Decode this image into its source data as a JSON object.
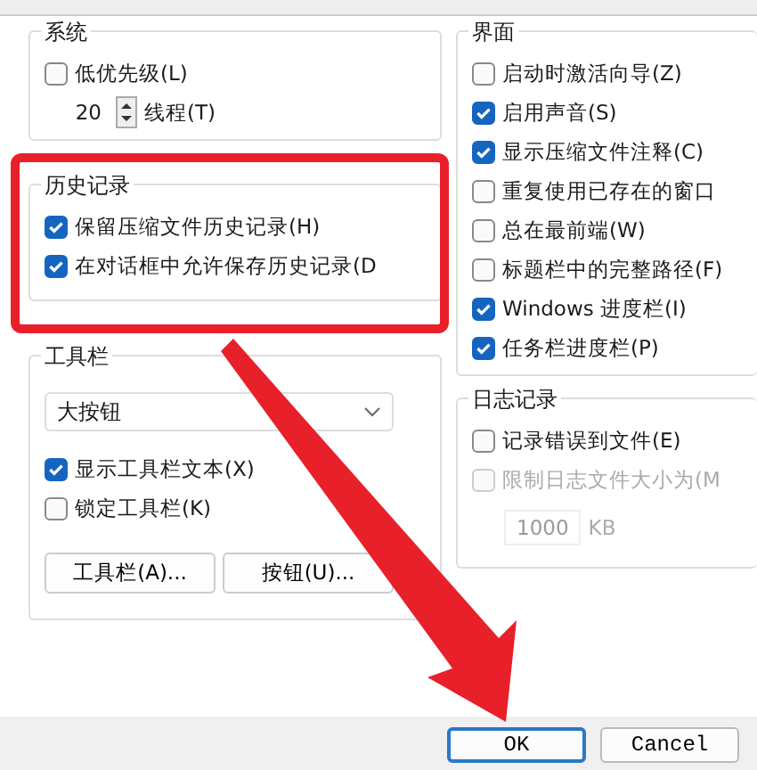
{
  "system": {
    "title": "系统",
    "low_priority": {
      "label": "低优先级(L)",
      "checked": false
    },
    "threads": {
      "value": "20",
      "label": "线程(T)"
    }
  },
  "history": {
    "title": "历史记录",
    "options": [
      {
        "label": "保留压缩文件历史记录(H)",
        "checked": true
      },
      {
        "label": "在对话框中允许保存历史记录(D",
        "checked": true
      }
    ]
  },
  "toolbar": {
    "title": "工具栏",
    "style": "大按钮",
    "options": [
      {
        "label": "显示工具栏文本(X)",
        "checked": true
      },
      {
        "label": "锁定工具栏(K)",
        "checked": false
      }
    ],
    "buttons": [
      "工具栏(A)...",
      "按钮(U)..."
    ]
  },
  "interface": {
    "title": "界面",
    "options": [
      {
        "label": "启动时激活向导(Z)",
        "checked": false
      },
      {
        "label": "启用声音(S)",
        "checked": true
      },
      {
        "label": "显示压缩文件注释(C)",
        "checked": true
      },
      {
        "label": "重复使用已存在的窗口",
        "checked": false
      },
      {
        "label": "总在最前端(W)",
        "checked": false
      },
      {
        "label": "标题栏中的完整路径(F)",
        "checked": false
      },
      {
        "label": "Windows 进度栏(I)",
        "checked": true
      },
      {
        "label": "任务栏进度栏(P)",
        "checked": true
      }
    ]
  },
  "log": {
    "title": "日志记录",
    "options": [
      {
        "label": "记录错误到文件(E)",
        "checked": false,
        "disabled": false
      },
      {
        "label": "限制日志文件大小为(M",
        "checked": false,
        "disabled": true
      }
    ],
    "size": {
      "value": "1000",
      "unit": "KB"
    }
  },
  "buttons": [
    {
      "label": "OK",
      "selected": true
    },
    {
      "label": "Cancel",
      "selected": false
    }
  ]
}
